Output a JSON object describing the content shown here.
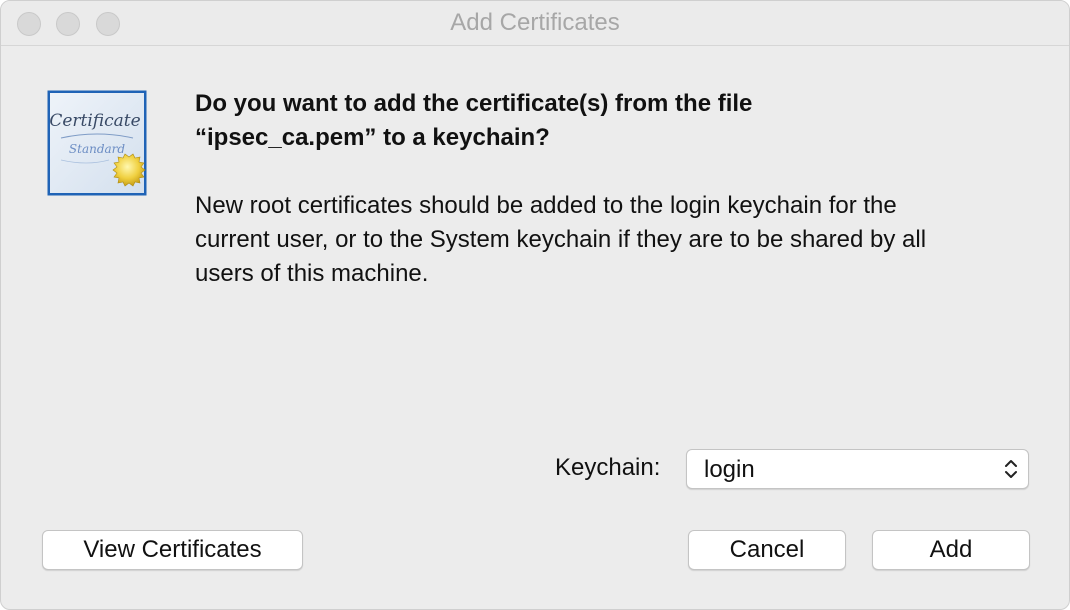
{
  "window": {
    "title": "Add Certificates"
  },
  "icon": {
    "name": "certificate-icon",
    "line1": "Certificate",
    "line2": "Standard"
  },
  "dialog": {
    "headline_line1": "Do you want to add the certificate(s) from the file",
    "headline_line2": "“ipsec_ca.pem” to a keychain?",
    "body_line1": "New root certificates should be added to the login keychain for the",
    "body_line2": "current user, or to the System keychain if they are to be shared by all",
    "body_line3": "users of this machine."
  },
  "keychain": {
    "label": "Keychain:",
    "selected": "login"
  },
  "buttons": {
    "view_certificates": "View Certificates",
    "cancel": "Cancel",
    "add": "Add"
  },
  "colors": {
    "window_bg": "#ececec",
    "title_text": "#a7a7a7",
    "icon_border": "#1f63b6"
  }
}
